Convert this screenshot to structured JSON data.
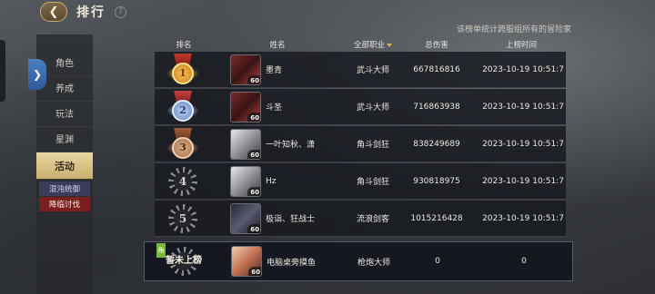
{
  "header": {
    "title": "排行",
    "back_icon": "chevron-left-icon",
    "help_label": "?"
  },
  "notice": "该榜单统计跨服组所有的冒险家",
  "sidebar": {
    "toggle_icon": "chevron-right-icon",
    "items": [
      {
        "label": "角色"
      },
      {
        "label": "养成"
      },
      {
        "label": "玩法"
      },
      {
        "label": "星渊"
      },
      {
        "label": "活动",
        "active": true
      }
    ],
    "subitems": [
      {
        "label": "混沌统御"
      },
      {
        "label": "降临讨伐",
        "active": true
      }
    ]
  },
  "table": {
    "columns": {
      "rank": "排名",
      "name": "姓名",
      "job": "全部职业",
      "damage": "总伤害",
      "time": "上榜时间"
    },
    "rows": [
      {
        "rank": "1",
        "medal": "gold",
        "avatar": "red",
        "level": "60",
        "name": "墨青",
        "job": "武斗大师",
        "damage": "667816816",
        "time": "2023-10-19 10:51:7"
      },
      {
        "rank": "2",
        "medal": "silver",
        "avatar": "red",
        "level": "60",
        "name": "斗圣",
        "job": "武斗大师",
        "damage": "716863938",
        "time": "2023-10-19 10:51:7"
      },
      {
        "rank": "3",
        "medal": "bronze",
        "avatar": "white",
        "level": "60",
        "name": "一叶知秋、潇",
        "job": "角斗剑狂",
        "damage": "838249689",
        "time": "2023-10-19 10:51:7"
      },
      {
        "rank": "4",
        "medal": "plain",
        "avatar": "white",
        "level": "60",
        "name": "Hz",
        "job": "角斗剑狂",
        "damage": "930818975",
        "time": "2023-10-19 10:51:7"
      },
      {
        "rank": "5",
        "medal": "plain",
        "avatar": "dark",
        "level": "60",
        "name": "极诣、狂战士",
        "job": "流浪剑客",
        "damage": "1015216428",
        "time": "2023-10-19 10:51:7"
      }
    ],
    "mine": {
      "badge": "角",
      "rank_text": "暂未上榜",
      "avatar": "gunner",
      "level": "60",
      "name": "电脑桌旁摸鱼",
      "job": "枪炮大师",
      "damage": "0",
      "time": "0"
    }
  }
}
